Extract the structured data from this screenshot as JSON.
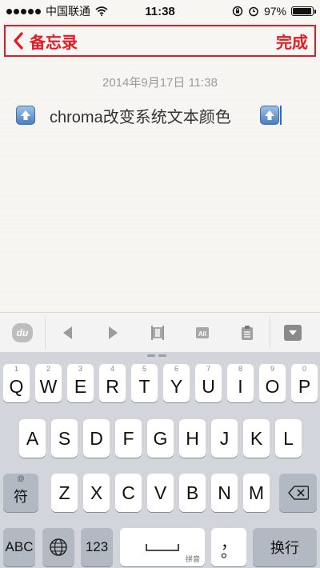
{
  "status_bar": {
    "carrier": "中国联通",
    "time": "11:38",
    "battery_percent_text": "97%",
    "battery_level": 0.97
  },
  "nav": {
    "back_label": "备忘录",
    "done_label": "完成",
    "accent_color": "#e01c24"
  },
  "note": {
    "date": "2014年9月17日 11:38",
    "text": "chroma改变系统文本颜色"
  },
  "toolbar": {
    "logo_text": "du",
    "icons": [
      "du-logo-icon",
      "arrow-left-icon",
      "arrow-right-icon",
      "select-text-icon",
      "select-all-icon",
      "clipboard-icon",
      "collapse-keyboard-icon"
    ]
  },
  "keyboard": {
    "row1": [
      {
        "digit": "1",
        "letter": "Q"
      },
      {
        "digit": "2",
        "letter": "W"
      },
      {
        "digit": "3",
        "letter": "E"
      },
      {
        "digit": "4",
        "letter": "R"
      },
      {
        "digit": "5",
        "letter": "T"
      },
      {
        "digit": "6",
        "letter": "Y"
      },
      {
        "digit": "7",
        "letter": "U"
      },
      {
        "digit": "8",
        "letter": "I"
      },
      {
        "digit": "9",
        "letter": "O"
      },
      {
        "digit": "0",
        "letter": "P"
      }
    ],
    "row2": [
      "A",
      "S",
      "D",
      "F",
      "G",
      "H",
      "J",
      "K",
      "L"
    ],
    "row3": [
      "Z",
      "X",
      "C",
      "V",
      "B",
      "N",
      "M"
    ],
    "symbol_key": {
      "sub": "@",
      "label": "符"
    },
    "abc_key": "ABC",
    "num_key": "123",
    "space_sub": "拼音",
    "comma_key": "，",
    "period_key": "。",
    "return_key": "换行"
  }
}
